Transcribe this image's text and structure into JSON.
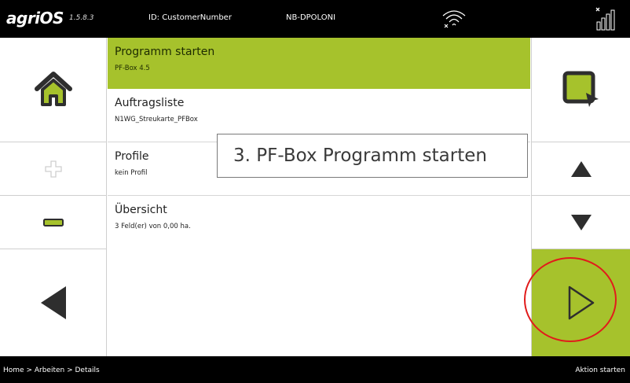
{
  "topbar": {
    "brand": "agriOS",
    "version": "1.5.8.3",
    "id_label": "ID: CustomerNumber",
    "device": "NB-DPOLONI",
    "wifi_icon": "wifi-disconnected-icon",
    "signal_icon": "signal-strength-icon"
  },
  "left_nav": {
    "home_icon": "home-icon",
    "plus_icon": "plus-icon",
    "minus_icon": "minus-icon",
    "back_icon": "back-arrow-icon"
  },
  "menu": {
    "items": [
      {
        "title": "Programm starten",
        "subtitle": "PF-Box 4.5",
        "selected": true
      },
      {
        "title": "Auftragsliste",
        "subtitle": "N1WG_Streukarte_PFBox",
        "selected": false
      },
      {
        "title": "Profile",
        "subtitle": "kein Profil",
        "selected": false
      },
      {
        "title": "Übersicht",
        "subtitle": "3 Feld(er) von 0,00 ha.",
        "selected": false
      }
    ]
  },
  "callout": {
    "text": "3. PF-Box Programm starten"
  },
  "right_nav": {
    "select_icon": "select-icon",
    "up_icon": "arrow-up-icon",
    "down_icon": "arrow-down-icon",
    "start_icon": "play-icon"
  },
  "bottombar": {
    "breadcrumb": "Home > Arbeiten > Details",
    "status": "Aktion starten"
  },
  "colors": {
    "accent_green": "#a6c22c",
    "bar_black": "#000000",
    "highlight_red": "#e11b1b"
  }
}
